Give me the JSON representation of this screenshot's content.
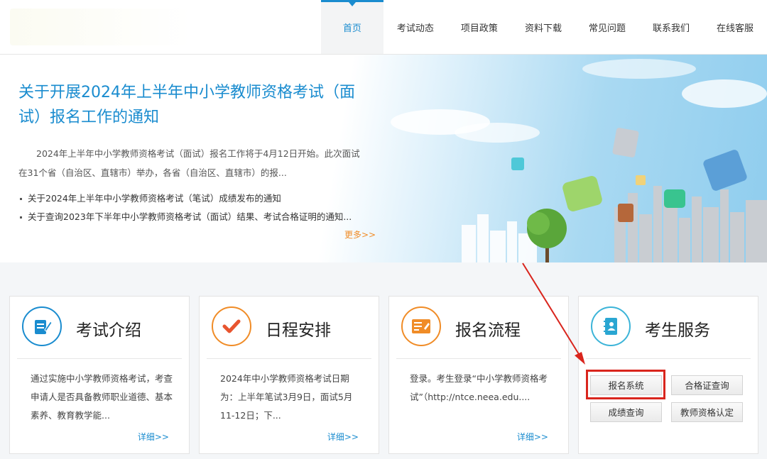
{
  "nav": {
    "items": [
      "首页",
      "考试动态",
      "项目政策",
      "资料下载",
      "常见问题",
      "联系我们",
      "在线客服"
    ],
    "active_index": 0
  },
  "banner": {
    "title": "关于开展2024年上半年中小学教师资格考试（面试）报名工作的通知",
    "description": "2024年上半年中小学教师资格考试（面试）报名工作将于4月12日开始。此次面试在31个省（自治区、直辖市）举办，各省（自治区、直辖市）的报...",
    "news": [
      "关于2024年上半年中小学教师资格考试（笔试）成绩发布的通知",
      "关于查询2023年下半年中小学教师资格考试（面试）结果、考试合格证明的通知..."
    ],
    "more": "更多>>"
  },
  "cards": [
    {
      "icon": "document-pen-icon",
      "title": "考试介绍",
      "text": "通过实施中小学教师资格考试，考查申请人是否具备教师职业道德、基本素养、教育教学能...",
      "more": "详细>>"
    },
    {
      "icon": "checkmark-icon",
      "title": "日程安排",
      "text": "2024年中小学教师资格考试日期为：上半年笔试3月9日，面试5月11-12日；下...",
      "more": "详细>>"
    },
    {
      "icon": "form-icon",
      "title": "报名流程",
      "text": "登录。考生登录“中小学教师资格考试”（http://ntce.neea.edu....",
      "more": "详细>>"
    }
  ],
  "services": {
    "icon": "contact-book-icon",
    "title": "考生服务",
    "buttons": [
      "报名系统",
      "合格证查询",
      "成绩查询",
      "教师资格认定"
    ]
  },
  "colors": {
    "primary": "#1a8ccf",
    "orange": "#f08c27",
    "annotation_red": "#d9251d"
  }
}
